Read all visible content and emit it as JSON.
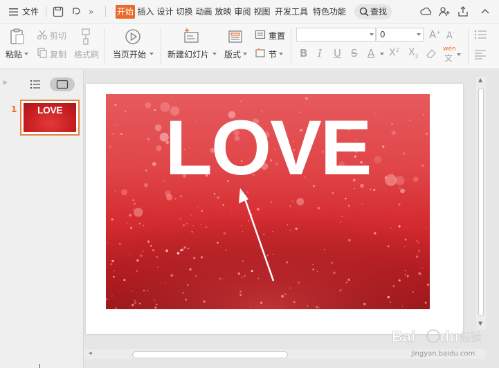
{
  "menu": {
    "file_label": "文件",
    "tabs": [
      {
        "label": "开始",
        "active": true
      },
      {
        "label": "插入"
      },
      {
        "label": "设计"
      },
      {
        "label": "切换"
      },
      {
        "label": "动画"
      },
      {
        "label": "放映"
      },
      {
        "label": "审阅"
      },
      {
        "label": "视图"
      },
      {
        "label": "开发工具"
      },
      {
        "label": "特色功能"
      }
    ],
    "search_label": "查找"
  },
  "ribbon": {
    "paste_label": "粘贴",
    "cut_label": "剪切",
    "copy_label": "复制",
    "format_painter_label": "格式刷",
    "from_current_label": "当页开始",
    "new_slide_label": "新建幻灯片",
    "layout_label": "版式",
    "reset_label": "重置",
    "section_label": "节",
    "font_name_value": "",
    "font_size_value": "0",
    "pinyin_label": "wén"
  },
  "slides_panel": {
    "slide_number": "1",
    "thumb_text": "LOVE"
  },
  "slide": {
    "image_text": "LOVE"
  },
  "colors": {
    "accent": "#e96a2b",
    "photo_red": "#d42b2f"
  }
}
